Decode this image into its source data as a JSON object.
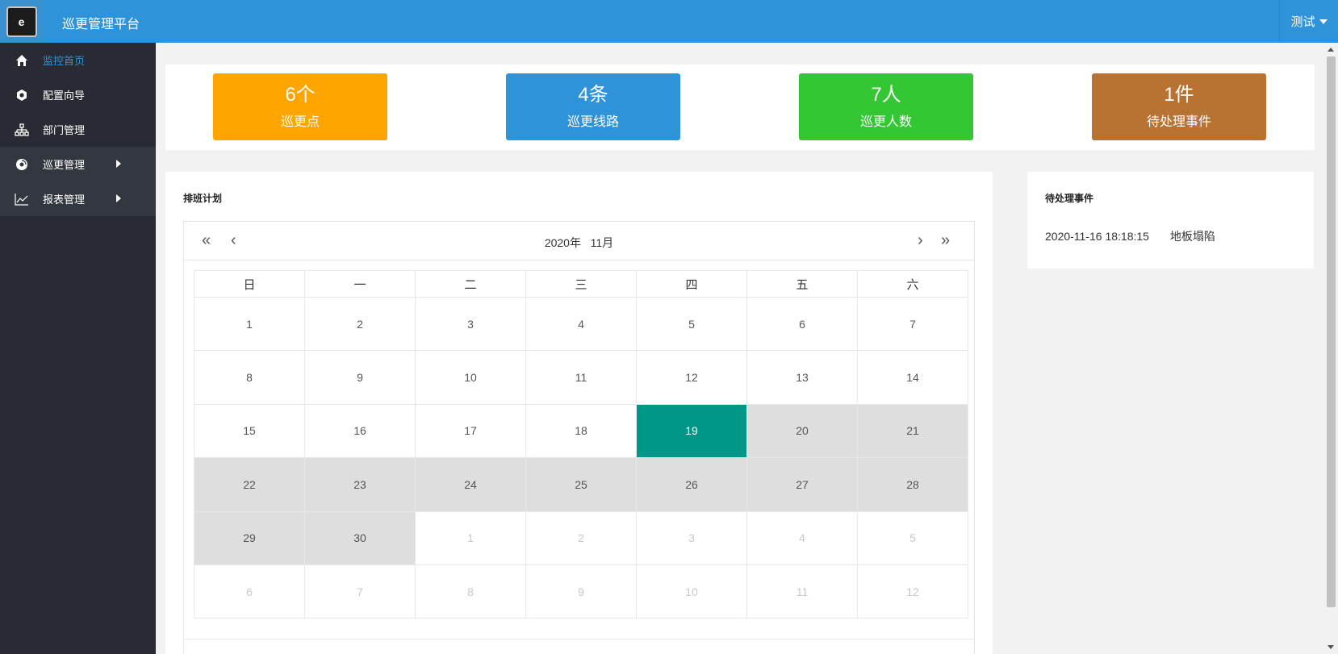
{
  "header": {
    "logo_text": "e",
    "title": "巡更管理平台",
    "user_name": "测试"
  },
  "sidebar": {
    "items": [
      {
        "label": "监控首页",
        "icon": "home-icon"
      },
      {
        "label": "配置向导",
        "icon": "gear-icon"
      },
      {
        "label": "部门管理",
        "icon": "sitemap-icon"
      },
      {
        "label": "巡更管理",
        "icon": "disc-icon"
      },
      {
        "label": "报表管理",
        "icon": "line-chart-icon"
      }
    ]
  },
  "stats": [
    {
      "value": "6个",
      "label": "巡更点",
      "color": "#ffa500"
    },
    {
      "value": "4条",
      "label": "巡更线路",
      "color": "#2f93d9"
    },
    {
      "value": "7人",
      "label": "巡更人数",
      "color": "#33c733"
    },
    {
      "value": "1件",
      "label": "待处理事件",
      "color": "#b87333"
    }
  ],
  "schedule": {
    "title": "排班计划",
    "calendar": {
      "year_label": "2020年",
      "month_label": "11月",
      "prev_year": "«",
      "prev_month": "‹",
      "next_month": "›",
      "next_year": "»",
      "weekdays": [
        "日",
        "一",
        "二",
        "三",
        "四",
        "五",
        "六"
      ],
      "weeks": [
        [
          "1",
          "2",
          "3",
          "4",
          "5",
          "6",
          "7"
        ],
        [
          "8",
          "9",
          "10",
          "11",
          "12",
          "13",
          "14"
        ],
        [
          "15",
          "16",
          "17",
          "18",
          "19",
          "20",
          "21"
        ],
        [
          "22",
          "23",
          "24",
          "25",
          "26",
          "27",
          "28"
        ],
        [
          "29",
          "30",
          "1",
          "2",
          "3",
          "4",
          "5"
        ],
        [
          "6",
          "7",
          "8",
          "9",
          "10",
          "11",
          "12"
        ]
      ],
      "today": "19",
      "scheduled_days": [
        "20",
        "21",
        "22",
        "23",
        "24",
        "25",
        "26",
        "27",
        "28",
        "29",
        "30"
      ]
    }
  },
  "pending_events": {
    "title": "待处理事件",
    "items": [
      {
        "time": "2020-11-16 18:18:15",
        "desc": "地板塌陷"
      }
    ]
  },
  "colors": {
    "header_bg": "#2f93d9",
    "sidebar_bg": "#282b33",
    "accent": "#2f93d9",
    "today": "#009688",
    "scheduled": "#dedede"
  }
}
